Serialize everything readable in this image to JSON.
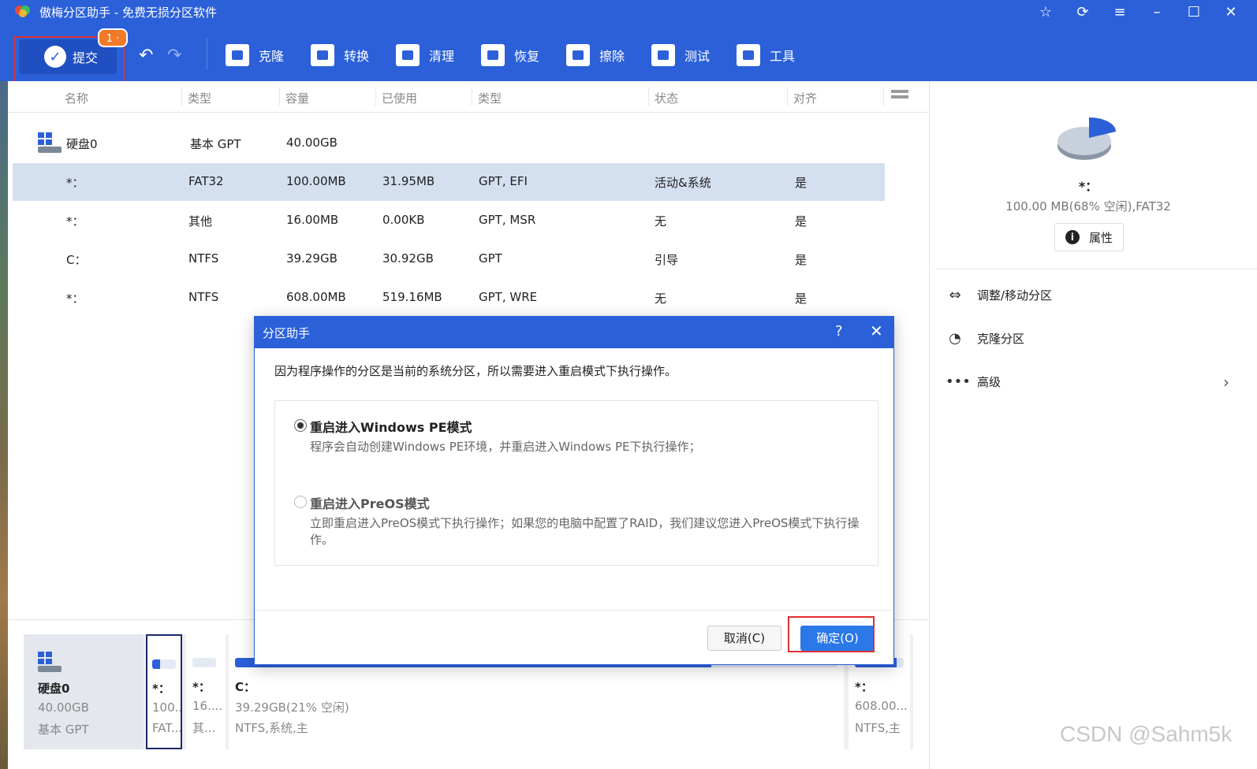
{
  "app": {
    "title": "傲梅分区助手 - 免费无损分区软件"
  },
  "toolbar": {
    "commit_label": "提交",
    "pending_badge": "1 ·",
    "tools": [
      "克隆",
      "转换",
      "清理",
      "恢复",
      "擦除",
      "测试",
      "工具"
    ]
  },
  "table": {
    "headers": [
      "名称",
      "类型",
      "容量",
      "已使用",
      "类型",
      "状态",
      "对齐"
    ],
    "disk": {
      "name": "硬盘0",
      "type": "基本 GPT",
      "capacity": "40.00GB"
    },
    "rows": [
      {
        "name": "*：",
        "type": "FAT32",
        "capacity": "100.00MB",
        "used": "31.95MB",
        "ptype": "GPT, EFI",
        "status": "活动&系统",
        "align": "是"
      },
      {
        "name": "*：",
        "type": "其他",
        "capacity": "16.00MB",
        "used": "0.00KB",
        "ptype": "GPT, MSR",
        "status": "无",
        "align": "是"
      },
      {
        "name": "C：",
        "type": "NTFS",
        "capacity": "39.29GB",
        "used": "30.92GB",
        "ptype": "GPT",
        "status": "引导",
        "align": "是"
      },
      {
        "name": "*：",
        "type": "NTFS",
        "capacity": "608.00MB",
        "used": "519.16MB",
        "ptype": "GPT, WRE",
        "status": "无",
        "align": "是"
      }
    ]
  },
  "right_panel": {
    "letter": "*：",
    "info": "100.00 MB(68% 空闲),FAT32",
    "properties_label": "属性",
    "actions": [
      "调整/移动分区",
      "克隆分区",
      "高级"
    ]
  },
  "disk_map": {
    "disk": {
      "name": "硬盘0",
      "size": "40.00GB",
      "type": "基本 GPT"
    },
    "partitions": [
      {
        "letter": "*：",
        "size": "100...",
        "info": "FAT...",
        "used_fraction": 0.32
      },
      {
        "letter": "*：",
        "size": "16....",
        "info": "其...",
        "used_fraction": 0.0
      },
      {
        "letter": "C：",
        "size": "39.29GB(21% 空闲)",
        "info": "NTFS,系统,主",
        "used_fraction": 0.79
      },
      {
        "letter": "*：",
        "size": "608.00...",
        "info": "NTFS,主",
        "used_fraction": 0.85
      }
    ]
  },
  "dialog": {
    "title": "分区助手",
    "help": "?",
    "close": "✕",
    "message": "因为程序操作的分区是当前的系统分区，所以需要进入重启模式下执行操作。",
    "options": [
      {
        "title": "重启进入Windows PE模式",
        "desc": "程序会自动创建Windows PE环境，并重启进入Windows PE下执行操作；",
        "selected": true
      },
      {
        "title": "重启进入PreOS模式",
        "desc": "立即重启进入PreOS模式下执行操作；如果您的电脑中配置了RAID，我们建议您进入PreOS模式下执行操作。",
        "selected": false
      }
    ],
    "cancel_label": "取消(C)",
    "ok_label": "确定(O)"
  },
  "watermark": "CSDN @Sahm5k",
  "colors": {
    "accent": "#2b60d9",
    "selected_row": "#d4dff0",
    "highlight_box": "#e03030",
    "badge": "#f07a28"
  }
}
